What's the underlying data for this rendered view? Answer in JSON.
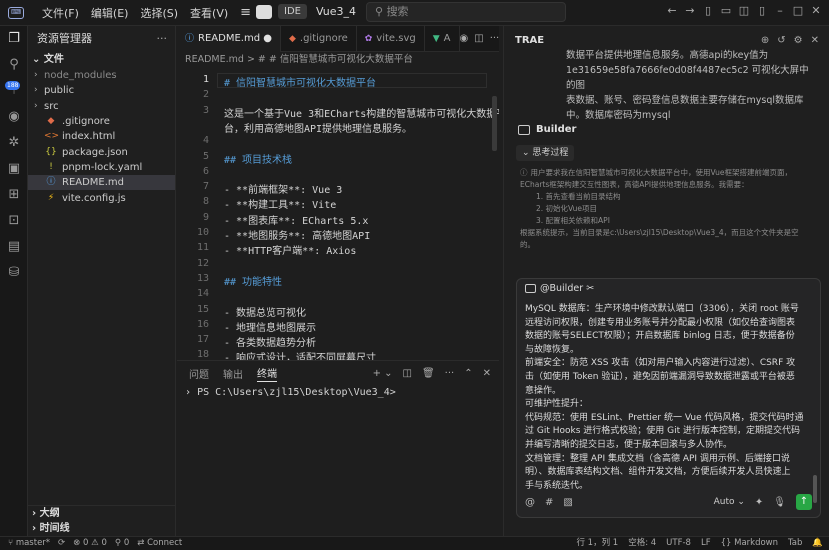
{
  "titlebar": {
    "menu": [
      "文件(F)",
      "编辑(E)",
      "选择(S)",
      "查看(V)"
    ],
    "mode_label": "IDE",
    "project": "Vue3_4",
    "search_placeholder": "搜索"
  },
  "sidebar": {
    "title": "资源管理器",
    "files_section": "文件",
    "items": [
      {
        "label": "node_modules",
        "type": "folder",
        "dim": true
      },
      {
        "label": "public",
        "type": "folder"
      },
      {
        "label": "src",
        "type": "folder"
      },
      {
        "label": ".gitignore",
        "type": "git"
      },
      {
        "label": "index.html",
        "type": "html"
      },
      {
        "label": "package.json",
        "type": "json"
      },
      {
        "label": "pnpm-lock.yaml",
        "type": "yaml"
      },
      {
        "label": "README.md",
        "type": "md",
        "selected": true
      },
      {
        "label": "vite.config.js",
        "type": "js"
      }
    ],
    "outline_section": "大纲",
    "timeline_section": "时间线"
  },
  "editor": {
    "tabs": [
      {
        "label": "README.md",
        "active": true,
        "modified": true
      },
      {
        "label": ".gitignore"
      },
      {
        "label": "vite.svg"
      },
      {
        "label": "A"
      }
    ],
    "breadcrumb": "README.md > # # 信阳智慧城市可视化大数据平台",
    "lines": [
      {
        "n": "1",
        "text": "# 信阳智慧城市可视化大数据平台",
        "kind": "h"
      },
      {
        "n": "2",
        "text": "",
        "kind": ""
      },
      {
        "n": "3",
        "text": "这是一个基于Vue 3和ECharts构建的智慧城市可视化大数据平",
        "kind": ""
      },
      {
        "n": "",
        "text": "台，利用高德地图API提供地理信息服务。",
        "kind": ""
      },
      {
        "n": "4",
        "text": "",
        "kind": ""
      },
      {
        "n": "5",
        "text": "## 项目技术栈",
        "kind": "h"
      },
      {
        "n": "6",
        "text": "",
        "kind": ""
      },
      {
        "n": "7",
        "text": "- **前端框架**: Vue 3",
        "kind": "li"
      },
      {
        "n": "8",
        "text": "- **构建工具**: Vite",
        "kind": "li"
      },
      {
        "n": "9",
        "text": "- **图表库**: ECharts 5.x",
        "kind": "li"
      },
      {
        "n": "10",
        "text": "- **地图服务**: 高德地图API",
        "kind": "li"
      },
      {
        "n": "11",
        "text": "- **HTTP客户端**: Axios",
        "kind": "li"
      },
      {
        "n": "12",
        "text": "",
        "kind": ""
      },
      {
        "n": "13",
        "text": "## 功能特性",
        "kind": "h"
      },
      {
        "n": "14",
        "text": "",
        "kind": ""
      },
      {
        "n": "15",
        "text": "- 数据总览可视化",
        "kind": "li"
      },
      {
        "n": "16",
        "text": "- 地理信息地图展示",
        "kind": "li"
      },
      {
        "n": "17",
        "text": "- 各类数据趋势分析",
        "kind": "li"
      },
      {
        "n": "18",
        "text": "- 响应式设计，适配不同屏幕尺寸",
        "kind": "li"
      }
    ]
  },
  "terminal": {
    "tabs": [
      "问题",
      "输出",
      "终端"
    ],
    "active_tab": "终端",
    "prompt": "PS C:\\Users\\zjl15\\Desktop\\Vue3_4>"
  },
  "chat": {
    "title": "TRAE",
    "user_msg": [
      "数据平台提供地理信息服务。高德api的key值为",
      "1e31659e58fa7666fe0d08f4487ec5c2     可视化大屏中的图",
      "表数据、账号、密码登信息数据主要存储在mysql数据库",
      "中。数据库密码为mysql"
    ],
    "agent_name": "Builder",
    "thinking_label": "思考过程",
    "reasoning": "用户要求我在信阳智慧城市可视化大数据平台中，使用Vue框架搭建前端页面，ECharts框架构建交互性图表，高德API提供地理信息服务。我需要：",
    "steps": [
      "1. 首先查看当前目录结构",
      "2. 初始化Vue项目",
      "3. 配置相关依赖和API"
    ],
    "reasoning_tail": "根据系统提示，当前目录是c:\\Users\\zjl15\\Desktop\\Vue3_4，而且这个文件夹是空的。",
    "input_mention": "@Builder",
    "input_lines": [
      "MySQL 数据库：生产环境中修改默认端口（3306），关闭 root 账号",
      "远程访问权限，创建专用业务账号并分配最小权限（如仅给查询图表",
      "数据的账号SELECT权限）；开启数据库 binlog 日志，便于数据备份",
      "与故障恢复。",
      "前端安全：防范 XSS 攻击（如对用户输入内容进行过滤）、CSRF 攻",
      "击（如使用 Token 验证），避免因前端漏洞导致数据泄露或平台被恶",
      "意操作。",
      "可维护性提升：",
      "代码规范：使用 ESLint、Prettier 统一 Vue 代码风格，提交代码时通",
      "过 Git Hooks 进行格式校验；使用 Git 进行版本控制，定期提交代码",
      "并编写清晰的提交日志，便于版本回滚与多人协作。",
      "文档管理：整理 API 集成文档（含高德 API 调用示例、后端接口说",
      "明）、数据库表结构文档、组件开发文档，方便后续开发人员快速上",
      "手与系统迭代。"
    ],
    "auto_label": "Auto"
  },
  "status": {
    "branch": "master*",
    "problems": "0",
    "warnings": "0",
    "ports": "0",
    "connect": "Connect",
    "position": "行 1，列 1",
    "spaces": "空格: 4",
    "encoding": "UTF-8",
    "eol": "LF",
    "language": "Markdown",
    "tab": "Tab"
  }
}
